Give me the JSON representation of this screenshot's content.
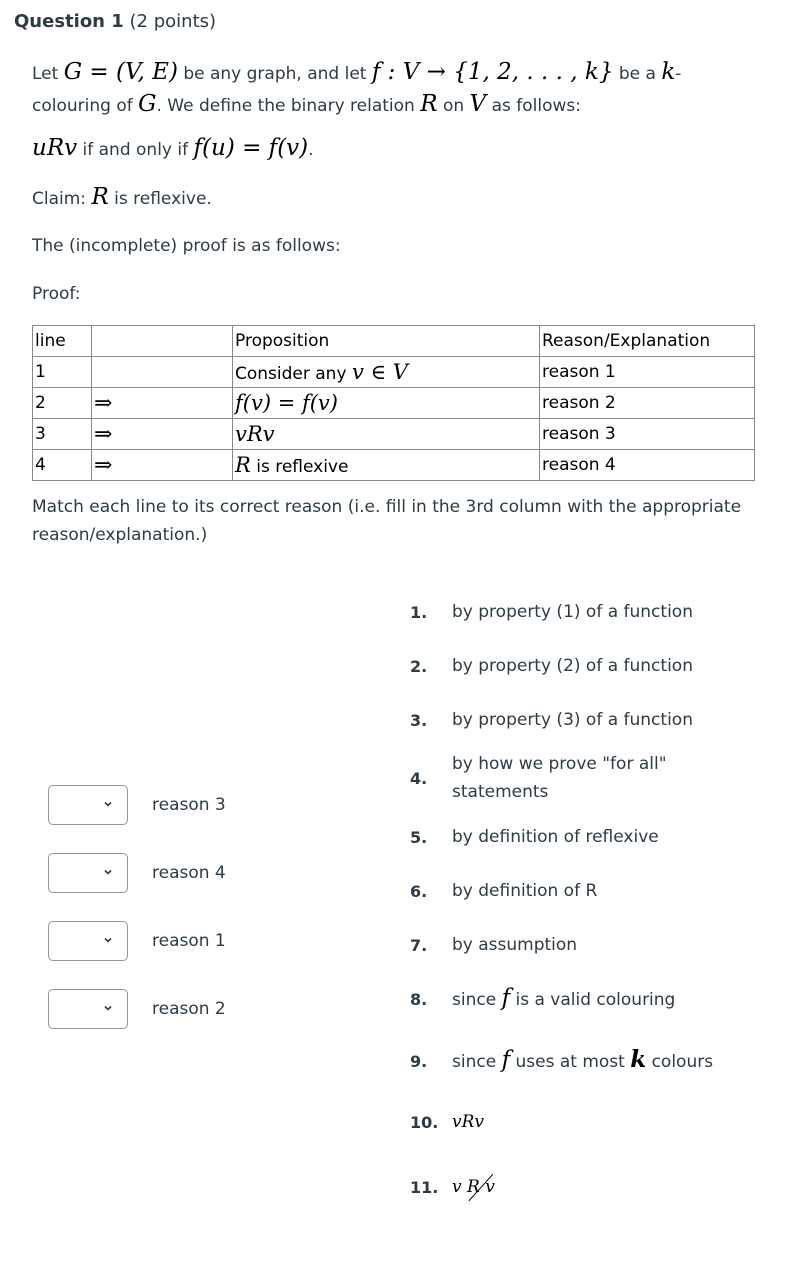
{
  "question": {
    "title": "Question 1",
    "points": "(2 points)"
  },
  "intro": {
    "t1": "Let ",
    "m_G_eq": "G = (V, E)",
    "t2": " be any graph, and let ",
    "m_f": "f : V → {1, 2, . . . , k}",
    "t3": " be a ",
    "m_k": "k",
    "t4": "-colouring of ",
    "m_G": "G",
    "t5": ". We define the binary relation ",
    "m_R": "R",
    "t6": " on ",
    "m_V": "V",
    "t7": " as follows:"
  },
  "definition": {
    "m_uRv": "uRv",
    "t1": " if and only if ",
    "m_eq": "f(u) = f(v)",
    "t2": "."
  },
  "claim": {
    "t1": "Claim: ",
    "m_R": "R",
    "t2": " is reflexive."
  },
  "incomplete_text": "The (incomplete) proof is as follows:",
  "proof_label": "Proof:",
  "proof_table": {
    "headers": [
      "line",
      "",
      "Proposition",
      "Reason/Explanation"
    ],
    "rows": [
      {
        "line": "1",
        "arrow": "",
        "prop_text": "Consider any ",
        "prop_math": "v ∈ V",
        "reason": "reason 1"
      },
      {
        "line": "2",
        "arrow": "⇒",
        "prop_text": "",
        "prop_math": "f(v) = f(v)",
        "reason": "reason 2"
      },
      {
        "line": "3",
        "arrow": "⇒",
        "prop_text": "",
        "prop_math": "vRv",
        "reason": "reason 3"
      },
      {
        "line": "4",
        "arrow": "⇒",
        "prop_math": "R",
        "prop_text": " is reflexive",
        "reason": "reason 4"
      }
    ]
  },
  "instructions": "Match each line to its correct reason (i.e. fill in the 3rd column with the appropriate reason/explanation.)",
  "matches": [
    {
      "label": "reason 3",
      "selected": ""
    },
    {
      "label": "reason 4",
      "selected": ""
    },
    {
      "label": "reason 1",
      "selected": ""
    },
    {
      "label": "reason 2",
      "selected": ""
    }
  ],
  "answers": [
    {
      "num": "1.",
      "text": "by property (1) of a function"
    },
    {
      "num": "2.",
      "text": "by property (2) of a function"
    },
    {
      "num": "3.",
      "text": "by property (3) of a function"
    },
    {
      "num": "4.",
      "text": "by how we prove \"for all\" statements"
    },
    {
      "num": "5.",
      "text": "by definition of reflexive"
    },
    {
      "num": "6.",
      "text": "by definition of R"
    },
    {
      "num": "7.",
      "text": "by assumption"
    },
    {
      "num": "8.",
      "t1": "since ",
      "m": "f",
      "t2": " is a valid colouring"
    },
    {
      "num": "9.",
      "t1": "since ",
      "m": "f",
      "t2": " uses at most ",
      "m2": "k",
      "t3": " colours"
    },
    {
      "num": "10.",
      "m": "vRv"
    },
    {
      "num": "11.",
      "m_a": "v ",
      "m_b": "R",
      "m_c": " v",
      "note": "v not-R v (R struck through)"
    }
  ]
}
